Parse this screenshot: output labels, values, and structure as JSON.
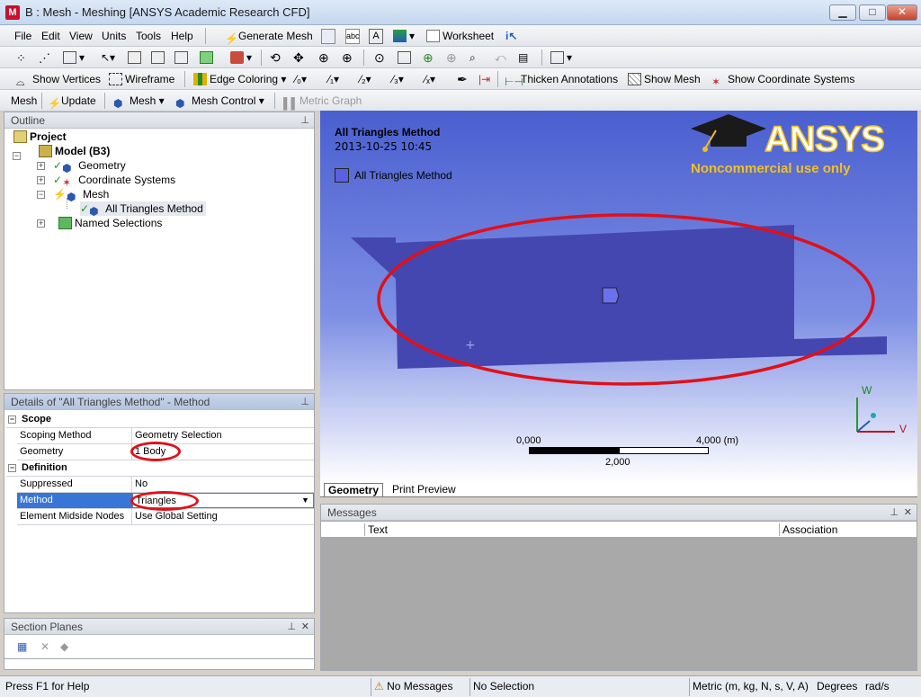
{
  "window": {
    "title": "B : Mesh - Meshing [ANSYS Academic Research CFD]",
    "icon": "M"
  },
  "menu": [
    "File",
    "Edit",
    "View",
    "Units",
    "Tools",
    "Help"
  ],
  "toolbar1": {
    "generate_mesh": "Generate Mesh",
    "worksheet": "Worksheet"
  },
  "toolbar3": {
    "show_vertices": "Show Vertices",
    "wireframe": "Wireframe",
    "edge_coloring": "Edge Coloring",
    "thicken_annotations": "Thicken Annotations",
    "show_mesh": "Show Mesh",
    "show_coordinate_systems": "Show Coordinate Systems"
  },
  "toolbar4": {
    "mesh": "Mesh",
    "update": "Update",
    "mesh_menu": "Mesh",
    "mesh_control": "Mesh Control",
    "metric_graph": "Metric Graph"
  },
  "outline": {
    "title": "Outline",
    "items": [
      "Project",
      "Model (B3)",
      "Geometry",
      "Coordinate Systems",
      "Mesh",
      "All Triangles Method",
      "Named Selections"
    ]
  },
  "details": {
    "title": "Details of \"All Triangles Method\" - Method",
    "sections": {
      "scope": "Scope",
      "definition": "Definition"
    },
    "rows": {
      "scoping_method": {
        "label": "Scoping Method",
        "value": "Geometry Selection"
      },
      "geometry": {
        "label": "Geometry",
        "value": "1 Body"
      },
      "suppressed": {
        "label": "Suppressed",
        "value": "No"
      },
      "method": {
        "label": "Method",
        "value": "Triangles"
      },
      "midside": {
        "label": "Element Midside Nodes",
        "value": "Use Global Setting"
      }
    }
  },
  "section_planes": {
    "title": "Section Planes"
  },
  "viewport": {
    "heading": "All Triangles Method",
    "date": "2013-10-25 10:45",
    "legend": "All Triangles Method",
    "legend_color": "#5b5fe0",
    "logo": "ANSYS",
    "logo_sub": "Noncommercial use only",
    "scale": {
      "left": "0,000",
      "right": "4,000 (m)",
      "mid": "2,000"
    },
    "axes": {
      "w": "W",
      "v": "V"
    }
  },
  "tabs": [
    "Geometry",
    "Print Preview"
  ],
  "messages": {
    "title": "Messages",
    "col_text": "Text",
    "col_assoc": "Association"
  },
  "status": {
    "help": "Press F1 for Help",
    "messages": "No Messages",
    "selection": "No Selection",
    "units": "Metric (m, kg, N, s, V, A)",
    "angle": "Degrees",
    "rate": "rad/s"
  },
  "colors": {
    "mesh_body": "#4547b0",
    "viewport_top": "#4a5fd0",
    "annotation_red": "#e0101a",
    "logo_yellow": "#f0c020"
  }
}
